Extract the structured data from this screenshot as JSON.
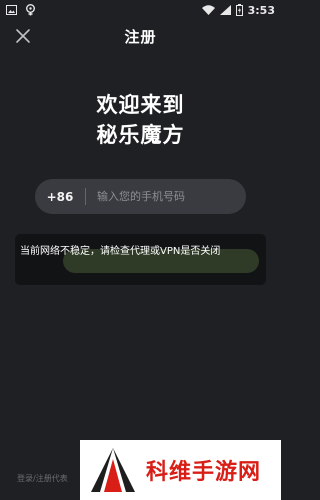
{
  "status": {
    "time": "3:53"
  },
  "header": {
    "title": "注册"
  },
  "headline": {
    "line1": "欢迎来到",
    "line2": "秘乐魔方"
  },
  "phone": {
    "country_code": "+86",
    "placeholder": "输入您的手机号码"
  },
  "toast": {
    "message": "当前网络不稳定，请检查代理或VPN是否关闭"
  },
  "footer": {
    "text": "登录/注册代表"
  },
  "watermark": {
    "text": "科维手游网"
  }
}
